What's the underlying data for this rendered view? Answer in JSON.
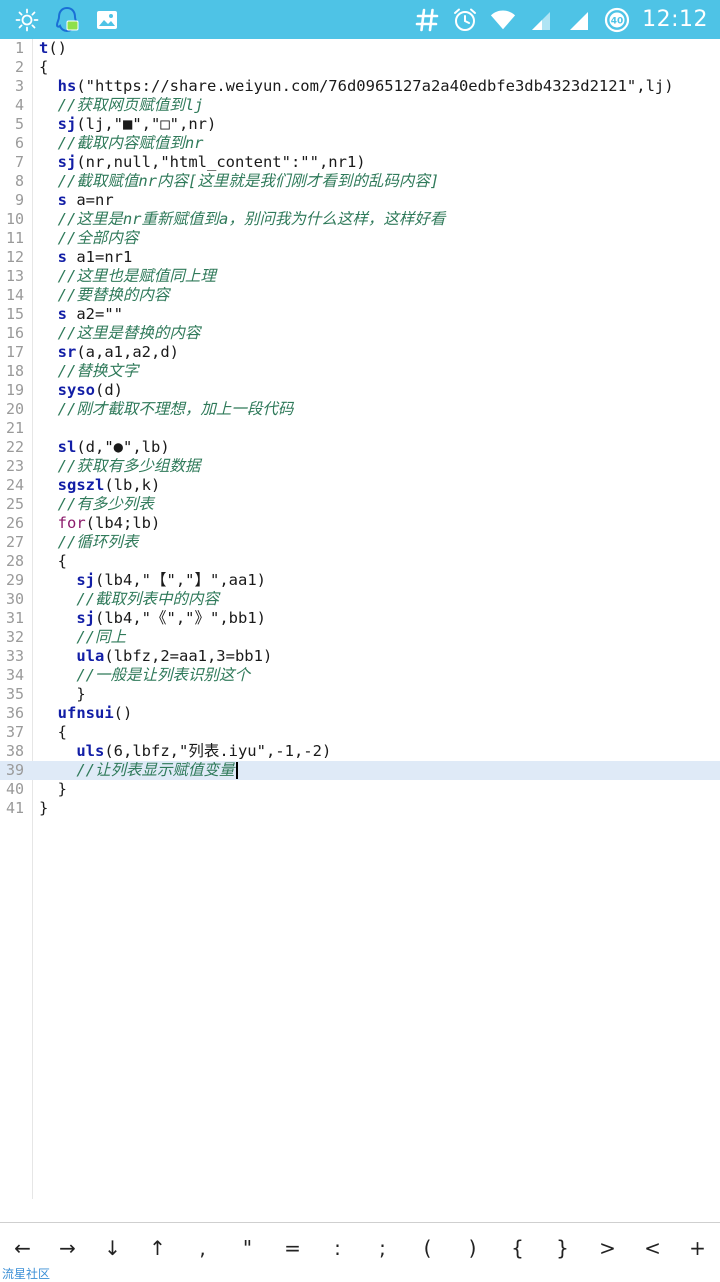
{
  "status_bar": {
    "time": "12:12",
    "battery_level": "40",
    "icons": [
      "brightness-icon",
      "qq-icon",
      "gallery-icon",
      "hash-icon",
      "alarm-icon",
      "wifi-icon",
      "signal-icon",
      "signal-icon-2",
      "battery-icon"
    ]
  },
  "editor": {
    "current_line": 39,
    "lines": [
      {
        "n": "1",
        "html": "<span class=\"kw\">t</span>()"
      },
      {
        "n": "2",
        "html": "{"
      },
      {
        "n": "3",
        "html": "  <span class=\"kw\">hs</span>(\"https://share.weiyun.com/76d0965127a2a40edbfe3db4323d2121\",lj)"
      },
      {
        "n": "4",
        "html": "  <span class=\"cm\">//获取网页赋值到lj</span>"
      },
      {
        "n": "5",
        "html": "  <span class=\"kw\">sj</span>(lj,\"■\",\"□\",nr)"
      },
      {
        "n": "6",
        "html": "  <span class=\"cm\">//截取内容赋值到nr</span>"
      },
      {
        "n": "7",
        "html": "  <span class=\"kw\">sj</span>(nr,null,\"html_content\":\"\",nr1)"
      },
      {
        "n": "8",
        "html": "  <span class=\"cm\">//截取赋值nr内容[这里就是我们刚才看到的乱码内容]</span>"
      },
      {
        "n": "9",
        "html": "  <span class=\"kw\">s</span> a=nr"
      },
      {
        "n": "10",
        "html": "  <span class=\"cm\">//这里是nr重新赋值到a，别问我为什么这样，这样好看</span>"
      },
      {
        "n": "11",
        "html": "  <span class=\"cm\">//全部内容</span>"
      },
      {
        "n": "12",
        "html": "  <span class=\"kw\">s</span> a1=nr1"
      },
      {
        "n": "13",
        "html": "  <span class=\"cm\">//这里也是赋值同上理</span>"
      },
      {
        "n": "14",
        "html": "  <span class=\"cm\">//要替换的内容</span>"
      },
      {
        "n": "15",
        "html": "  <span class=\"kw\">s</span> a2=\"\""
      },
      {
        "n": "16",
        "html": "  <span class=\"cm\">//这里是替换的内容</span>"
      },
      {
        "n": "17",
        "html": "  <span class=\"kw\">sr</span>(a,a1,a2,d)"
      },
      {
        "n": "18",
        "html": "  <span class=\"cm\">//替换文字</span>"
      },
      {
        "n": "19",
        "html": "  <span class=\"kw\">syso</span>(d)"
      },
      {
        "n": "20",
        "html": "  <span class=\"cm\">//刚才截取不理想，加上一段代码</span>"
      },
      {
        "n": "21",
        "html": ""
      },
      {
        "n": "22",
        "html": "  <span class=\"kw\">sl</span>(d,\"●\",lb)"
      },
      {
        "n": "23",
        "html": "  <span class=\"cm\">//获取有多少组数据</span>"
      },
      {
        "n": "24",
        "html": "  <span class=\"kw\">sgszl</span>(lb,k)"
      },
      {
        "n": "25",
        "html": "  <span class=\"cm\">//有多少列表</span>"
      },
      {
        "n": "26",
        "html": "  <span class=\"kw2\">for</span>(lb4;lb)"
      },
      {
        "n": "27",
        "html": "  <span class=\"cm\">//循环列表</span>"
      },
      {
        "n": "28",
        "html": "  {"
      },
      {
        "n": "29",
        "html": "    <span class=\"kw\">sj</span>(lb4,\"【\",\"】\",aa1)"
      },
      {
        "n": "30",
        "html": "    <span class=\"cm\">//截取列表中的内容</span>"
      },
      {
        "n": "31",
        "html": "    <span class=\"kw\">sj</span>(lb4,\"《\",\"》\",bb1)"
      },
      {
        "n": "32",
        "html": "    <span class=\"cm\">//同上</span>"
      },
      {
        "n": "33",
        "html": "    <span class=\"kw\">ula</span>(lbfz,2=aa1,3=bb1)"
      },
      {
        "n": "34",
        "html": "    <span class=\"cm\">//一般是让列表识别这个</span>"
      },
      {
        "n": "35",
        "html": "    }"
      },
      {
        "n": "36",
        "html": "  <span class=\"kw\">ufnsui</span>()"
      },
      {
        "n": "37",
        "html": "  {"
      },
      {
        "n": "38",
        "html": "    <span class=\"kw\">uls</span>(6,lbfz,\"列表.iyu\",-1,-2)"
      },
      {
        "n": "39",
        "html": "    <span class=\"cm\">//让列表显示赋值变量</span><span class=\"caret\"></span>"
      },
      {
        "n": "40",
        "html": "  }"
      },
      {
        "n": "41",
        "html": "}"
      }
    ]
  },
  "symbol_bar": {
    "keys": [
      "←",
      "→",
      "↓",
      "↑",
      ",",
      "\"",
      "=",
      ":",
      ";",
      "(",
      ")",
      "{",
      "}",
      ">",
      "<",
      "+"
    ]
  },
  "watermark": "流星社区"
}
